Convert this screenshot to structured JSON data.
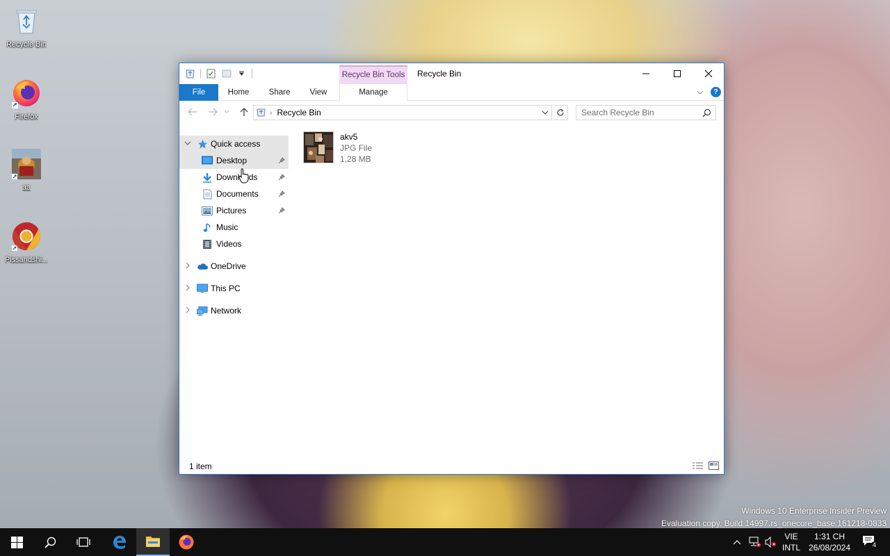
{
  "desktop": {
    "icons": [
      {
        "label": "Recycle Bin"
      },
      {
        "label": "Firefox"
      },
      {
        "label": "aa"
      },
      {
        "label": "Pissandshi..."
      }
    ]
  },
  "window": {
    "title": "Recycle Bin",
    "contextual_tab_group": "Recycle Bin Tools",
    "ribbon_tabs": {
      "file": "File",
      "home": "Home",
      "share": "Share",
      "view": "View",
      "manage": "Manage"
    },
    "address": {
      "crumb": "Recycle Bin"
    },
    "search": {
      "placeholder": "Search Recycle Bin"
    },
    "help_label": "?",
    "nav": {
      "quick_access": "Quick access",
      "desktop": "Desktop",
      "downloads": "Downloads",
      "documents": "Documents",
      "pictures": "Pictures",
      "music": "Music",
      "videos": "Videos",
      "onedrive": "OneDrive",
      "this_pc": "This PC",
      "network": "Network"
    },
    "files": [
      {
        "name": "akv5",
        "type": "JPG File",
        "size": "1,28 MB"
      }
    ],
    "status": "1 item"
  },
  "watermark": {
    "line1": "Windows 10 Enterprise Insider Preview",
    "line2": "Evaluation copy. Build 14997.rs_onecore_base.161218-0833"
  },
  "taskbar": {
    "language": {
      "top": "VIE",
      "bottom": "INTL"
    },
    "clock": {
      "time": "1:31 CH",
      "date": "26/08/2024"
    },
    "notification_count": "4"
  },
  "colors": {
    "accent": "#1979ca",
    "contextual_tab": "#f1d9f4",
    "taskbar": "#101010",
    "selection": "#e5e5e5"
  }
}
